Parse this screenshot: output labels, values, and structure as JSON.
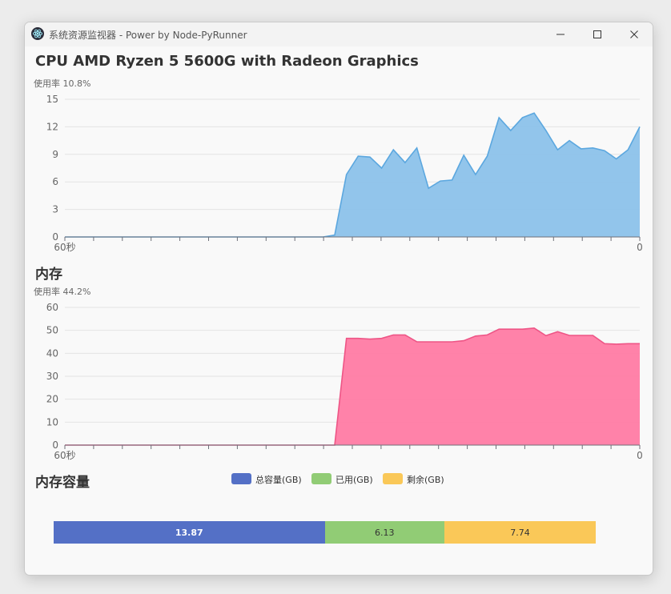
{
  "window": {
    "title": "系统资源监视器 - Power by Node-PyRunner"
  },
  "cpu": {
    "title": "CPU AMD Ryzen 5 5600G with Radeon Graphics",
    "subtitle": "使用率 10.8%",
    "color": "#5ba7df",
    "fill": "#8cc2ea",
    "chart_data": {
      "type": "area",
      "title": "CPU AMD Ryzen 5 5600G with Radeon Graphics",
      "subtitle": "使用率 10.8%",
      "x_labels": [
        "60秒",
        "0"
      ],
      "ylim": [
        0,
        15
      ],
      "y_ticks": [
        0,
        3,
        6,
        9,
        12,
        15
      ],
      "grid": true,
      "values": [
        0,
        0,
        0,
        0,
        0,
        0,
        0,
        0,
        0,
        0,
        0,
        0,
        0,
        0,
        0,
        0,
        0,
        0,
        0,
        0,
        0,
        0,
        0,
        0.2,
        6.8,
        8.8,
        8.7,
        7.5,
        9.5,
        8.1,
        9.7,
        5.3,
        6.1,
        6.2,
        8.9,
        6.8,
        8.8,
        13,
        11.6,
        13,
        13.5,
        11.6,
        9.5,
        10.5,
        9.6,
        9.7,
        9.4,
        8.5,
        9.5,
        12
      ]
    }
  },
  "memory": {
    "title": "内存",
    "subtitle": "使用率 44.2%",
    "color": "#ee5586",
    "fill": "#ff7ba4",
    "chart_data": {
      "type": "area",
      "title": "内存",
      "subtitle": "使用率 44.2%",
      "x_labels": [
        "60秒",
        "0"
      ],
      "ylim": [
        0,
        60
      ],
      "y_ticks": [
        0,
        10,
        20,
        30,
        40,
        50,
        60
      ],
      "grid": true,
      "values": [
        0,
        0,
        0,
        0,
        0,
        0,
        0,
        0,
        0,
        0,
        0,
        0,
        0,
        0,
        0,
        0,
        0,
        0,
        0,
        0,
        0,
        0,
        0,
        0,
        46.5,
        46.5,
        46.2,
        46.5,
        48,
        48,
        45,
        45,
        45,
        45,
        45.5,
        47.5,
        48,
        50.5,
        50.5,
        50.5,
        51,
        47.7,
        49.4,
        47.8,
        47.8,
        47.8,
        44.2,
        44,
        44.2,
        44.2
      ]
    }
  },
  "capacity": {
    "title": "内存容量",
    "chart_data": {
      "type": "bar",
      "orientation": "horizontal-stacked",
      "title": "内存容量",
      "series": [
        {
          "name": "总容量(GB)",
          "value": 13.87,
          "color": "#5470c6",
          "label": "13.87"
        },
        {
          "name": "已用(GB)",
          "value": 6.13,
          "color": "#91cc75",
          "label": "6.13"
        },
        {
          "name": "剩余(GB)",
          "value": 7.74,
          "color": "#fac858",
          "label": "7.74"
        }
      ]
    }
  }
}
